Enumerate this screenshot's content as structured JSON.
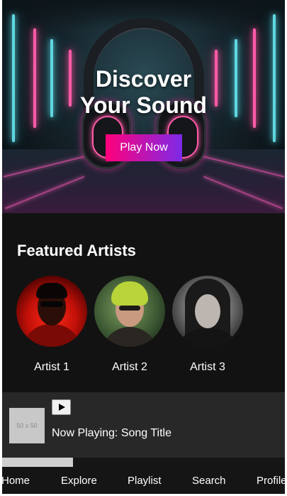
{
  "hero": {
    "title_line1": "Discover",
    "title_line2": "Your Sound",
    "cta_label": "Play Now",
    "cta_gradient": [
      "#ff007a",
      "#7d2ae8"
    ]
  },
  "featured": {
    "title": "Featured Artists",
    "artists": [
      {
        "name": "Artist 1"
      },
      {
        "name": "Artist 2"
      },
      {
        "name": "Artist 3"
      }
    ]
  },
  "player": {
    "thumbnail_placeholder": "50 x 50",
    "play_icon": "play-icon",
    "now_playing": "Now Playing: Song Title",
    "progress_fraction": 0.25
  },
  "nav": {
    "items": [
      "Home",
      "Explore",
      "Playlist",
      "Search",
      "Profile"
    ]
  },
  "colors": {
    "background": "#121212",
    "player_bar": "#282828"
  }
}
